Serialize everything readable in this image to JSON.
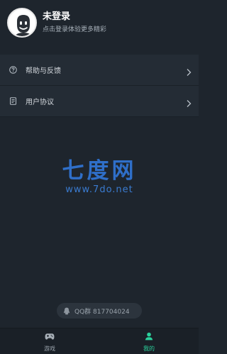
{
  "profile": {
    "name": "未登录",
    "subtitle": "点击登录体验更多精彩"
  },
  "menu": {
    "items": [
      {
        "label": "帮助与反馈",
        "icon": "help-circle-icon"
      },
      {
        "label": "用户协议",
        "icon": "document-icon"
      }
    ]
  },
  "watermark": {
    "logo": "七度网",
    "url": "www.7do.net"
  },
  "qq": {
    "text": "QQ群 817704024",
    "icon": "qq-penguin-icon"
  },
  "tabbar": {
    "games_label": "游戏",
    "mine_label": "我的"
  },
  "colors": {
    "background": "#1e252d",
    "row": "#242c35",
    "accent": "#2bd19c",
    "watermark": "#2f6fc9"
  }
}
